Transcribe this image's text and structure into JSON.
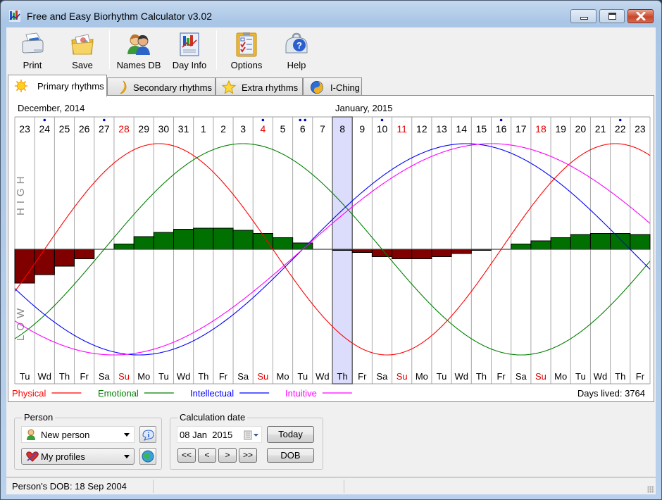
{
  "window": {
    "title": "Free and Easy Biorhythm Calculator v3.02",
    "controls": [
      "minimize",
      "maximize",
      "close"
    ]
  },
  "toolbar": {
    "buttons": [
      {
        "label": "Print",
        "icon": "printer-icon"
      },
      {
        "label": "Save",
        "icon": "folder-save-icon"
      },
      {
        "label": "Names DB",
        "icon": "people-icon"
      },
      {
        "label": "Day Info",
        "icon": "chart-document-icon"
      },
      {
        "label": "Options",
        "icon": "checklist-icon"
      },
      {
        "label": "Help",
        "icon": "help-toolbox-icon"
      }
    ]
  },
  "tabs": [
    {
      "label": "Primary rhythms",
      "icon": "sun-icon",
      "active": true
    },
    {
      "label": "Secondary rhythms",
      "icon": "moon-icon",
      "active": false
    },
    {
      "label": "Extra rhythms",
      "icon": "star-icon",
      "active": false
    },
    {
      "label": "I-Ching",
      "icon": "yin-yang-icon",
      "active": false
    }
  ],
  "chart_data": {
    "type": "line",
    "title": "Primary rhythms",
    "month_labels": [
      {
        "label": "December, 2014",
        "start_index": 0
      },
      {
        "label": "January, 2015",
        "start_index": 16
      }
    ],
    "axis_labels": {
      "high": "HIGH",
      "low": "LOW"
    },
    "ylim": [
      -1,
      1
    ],
    "selected_index": 16,
    "days": [
      {
        "day": "23",
        "wd": "Tu",
        "sunday": false,
        "dots": 0
      },
      {
        "day": "24",
        "wd": "Wd",
        "sunday": false,
        "dots": 1
      },
      {
        "day": "25",
        "wd": "Th",
        "sunday": false,
        "dots": 0
      },
      {
        "day": "26",
        "wd": "Fr",
        "sunday": false,
        "dots": 0
      },
      {
        "day": "27",
        "wd": "Sa",
        "sunday": false,
        "dots": 1
      },
      {
        "day": "28",
        "wd": "Su",
        "sunday": true,
        "dots": 0
      },
      {
        "day": "29",
        "wd": "Mo",
        "sunday": false,
        "dots": 0
      },
      {
        "day": "30",
        "wd": "Tu",
        "sunday": false,
        "dots": 0
      },
      {
        "day": "31",
        "wd": "Wd",
        "sunday": false,
        "dots": 0
      },
      {
        "day": "1",
        "wd": "Th",
        "sunday": false,
        "dots": 0
      },
      {
        "day": "2",
        "wd": "Fr",
        "sunday": false,
        "dots": 0
      },
      {
        "day": "3",
        "wd": "Sa",
        "sunday": false,
        "dots": 0
      },
      {
        "day": "4",
        "wd": "Su",
        "sunday": true,
        "dots": 1
      },
      {
        "day": "5",
        "wd": "Mo",
        "sunday": false,
        "dots": 0
      },
      {
        "day": "6",
        "wd": "Tu",
        "sunday": false,
        "dots": 2
      },
      {
        "day": "7",
        "wd": "Wd",
        "sunday": false,
        "dots": 0
      },
      {
        "day": "8",
        "wd": "Th",
        "sunday": false,
        "dots": 0
      },
      {
        "day": "9",
        "wd": "Fr",
        "sunday": false,
        "dots": 0
      },
      {
        "day": "10",
        "wd": "Sa",
        "sunday": false,
        "dots": 1
      },
      {
        "day": "11",
        "wd": "Su",
        "sunday": true,
        "dots": 0
      },
      {
        "day": "12",
        "wd": "Mo",
        "sunday": false,
        "dots": 0
      },
      {
        "day": "13",
        "wd": "Tu",
        "sunday": false,
        "dots": 0
      },
      {
        "day": "14",
        "wd": "Wd",
        "sunday": false,
        "dots": 0
      },
      {
        "day": "15",
        "wd": "Th",
        "sunday": false,
        "dots": 0
      },
      {
        "day": "16",
        "wd": "Fr",
        "sunday": false,
        "dots": 1
      },
      {
        "day": "17",
        "wd": "Sa",
        "sunday": false,
        "dots": 0
      },
      {
        "day": "18",
        "wd": "Su",
        "sunday": true,
        "dots": 0
      },
      {
        "day": "19",
        "wd": "Mo",
        "sunday": false,
        "dots": 0
      },
      {
        "day": "20",
        "wd": "Tu",
        "sunday": false,
        "dots": 0
      },
      {
        "day": "21",
        "wd": "Wd",
        "sunday": false,
        "dots": 0
      },
      {
        "day": "22",
        "wd": "Th",
        "sunday": false,
        "dots": 1
      },
      {
        "day": "23",
        "wd": "Fr",
        "sunday": false,
        "dots": 0
      }
    ],
    "days_lived_at_selected": 3764,
    "series": [
      {
        "name": "Physical",
        "period_days": 23,
        "color": "#ff0000"
      },
      {
        "name": "Emotional",
        "period_days": 28,
        "color": "#008000"
      },
      {
        "name": "Intellectual",
        "period_days": 33,
        "color": "#0000ff"
      },
      {
        "name": "Intuitive",
        "period_days": 38,
        "color": "#ff00ff"
      }
    ],
    "bars": {
      "positive_color": "#007000",
      "negative_color": "#800000",
      "values": [
        -0.32,
        -0.24,
        -0.16,
        -0.09,
        0.0,
        0.05,
        0.12,
        0.16,
        0.19,
        0.2,
        0.2,
        0.18,
        0.15,
        0.11,
        0.06,
        0.0,
        -0.01,
        -0.03,
        -0.07,
        -0.09,
        -0.09,
        -0.07,
        -0.04,
        -0.01,
        0.0,
        0.05,
        0.08,
        0.11,
        0.14,
        0.15,
        0.15,
        0.14
      ]
    },
    "legend": [
      {
        "label": "Physical",
        "color": "#ff0000"
      },
      {
        "label": "Emotional",
        "color": "#008000"
      },
      {
        "label": "Intellectual",
        "color": "#0000ff"
      },
      {
        "label": "Intuitive",
        "color": "#ff00ff"
      }
    ],
    "legend_placement": "bottom-left",
    "days_lived_label": "Days lived: 3764",
    "colors": {
      "sunday_text": "#e00000",
      "dot": "#0000c0",
      "selected_column": "#dcdcfc"
    }
  },
  "person": {
    "group_label": "Person",
    "person_combo": "New person",
    "profiles_combo": "My profiles"
  },
  "calculation": {
    "group_label": "Calculation date",
    "date_value": "08 Jan  2015",
    "today_label": "Today",
    "dob_label": "DOB",
    "nav": [
      "<<",
      "<",
      ">",
      ">>"
    ]
  },
  "status": {
    "dob_text": "Person's DOB: 18 Sep 2004"
  }
}
